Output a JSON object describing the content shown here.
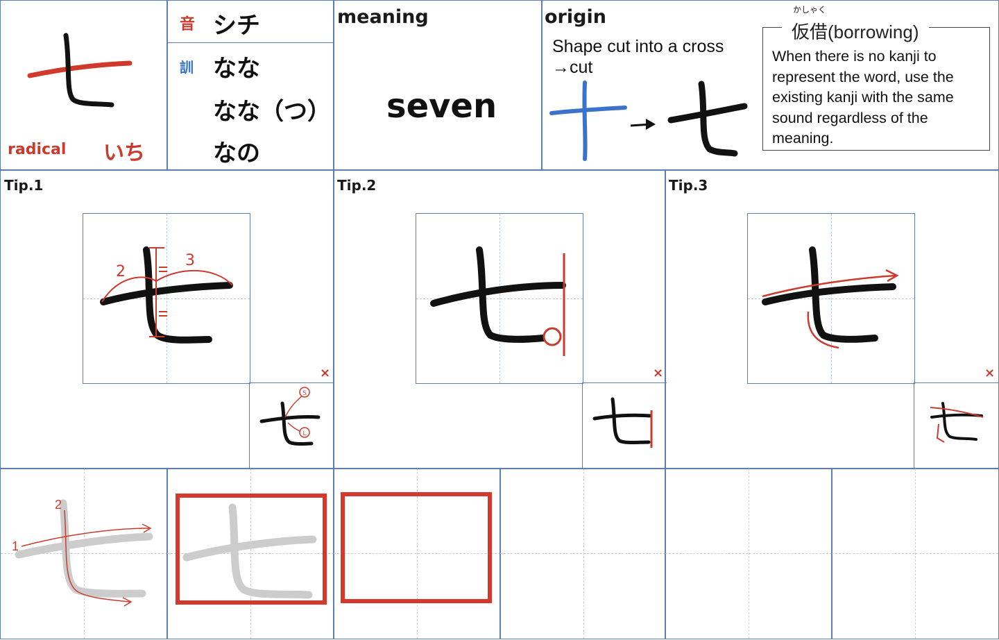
{
  "header": {
    "radical": {
      "label": "radical",
      "reading": "いち"
    },
    "readings": {
      "on_badge": "音",
      "on": "シチ",
      "kun_badge": "訓",
      "kun": [
        "なな",
        "なな（つ）",
        "なの"
      ]
    },
    "meaning": {
      "label": "meaning",
      "value": "seven"
    },
    "origin": {
      "label": "origin",
      "description_line1": "Shape cut into a cross",
      "description_line2": "→cut",
      "borrowing_furigana": "かしゃく",
      "borrowing_title": "仮借(borrowing)",
      "borrowing_text": [
        "When there is no kanji to",
        "represent the word, use the",
        "existing kanji with the same",
        "sound regardless of the",
        "meaning."
      ]
    }
  },
  "tips": [
    {
      "label": "Tip.1",
      "stroke_numbers": [
        "2",
        "3"
      ],
      "mark": "×",
      "mini_badges": [
        "S",
        "L"
      ]
    },
    {
      "label": "Tip.2",
      "mark": "×"
    },
    {
      "label": "Tip.3",
      "mark": "×"
    }
  ],
  "practice": {
    "stroke_order_numbers": [
      "1",
      "2"
    ]
  },
  "colors": {
    "grid": "#5b7fb0",
    "accent": "#cc3a2e",
    "origin_blue": "#3a73c9",
    "trace_gray": "#cccccc"
  }
}
